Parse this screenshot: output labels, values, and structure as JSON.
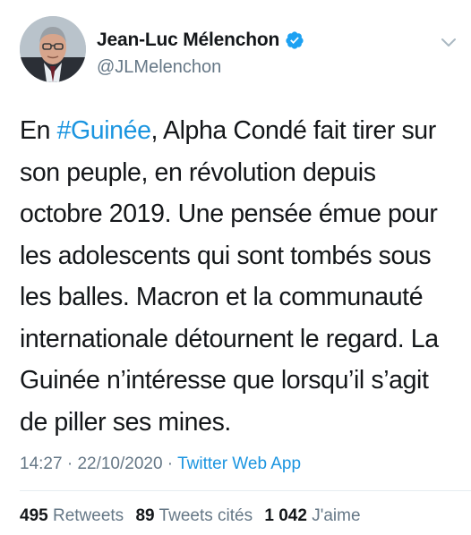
{
  "tweet": {
    "author": {
      "display_name": "Jean-Luc Mélenchon",
      "handle": "@JLMelenchon",
      "verified": true,
      "avatar_icon": "profile-photo",
      "options_icon": "chevron-down-icon"
    },
    "text": {
      "before_hashtag": "En ",
      "hashtag": "#Guinée",
      "after_hashtag": ", Alpha Condé fait tirer sur son peuple, en révolution depuis octobre 2019. Une pensée émue pour les adolescents qui sont tombés sous les balles. Macron et la communauté internationale détournent le regard. La Guinée n’intéresse que lorsqu’il s’agit de piller ses mines."
    },
    "meta": {
      "time": "14:27",
      "separator": " · ",
      "date": "22/10/2020",
      "separator2": " · ",
      "source": "Twitter Web App"
    },
    "stats": {
      "retweets_count": "495",
      "retweets_label": "Retweets",
      "quotes_count": "89",
      "quotes_label": "Tweets cités",
      "likes_count": "1 042",
      "likes_label": "J'aime"
    },
    "colors": {
      "link": "#1b95e0",
      "secondary_text": "#657786",
      "primary_text": "#14171a",
      "verified_badge": "#1da1f2"
    }
  }
}
